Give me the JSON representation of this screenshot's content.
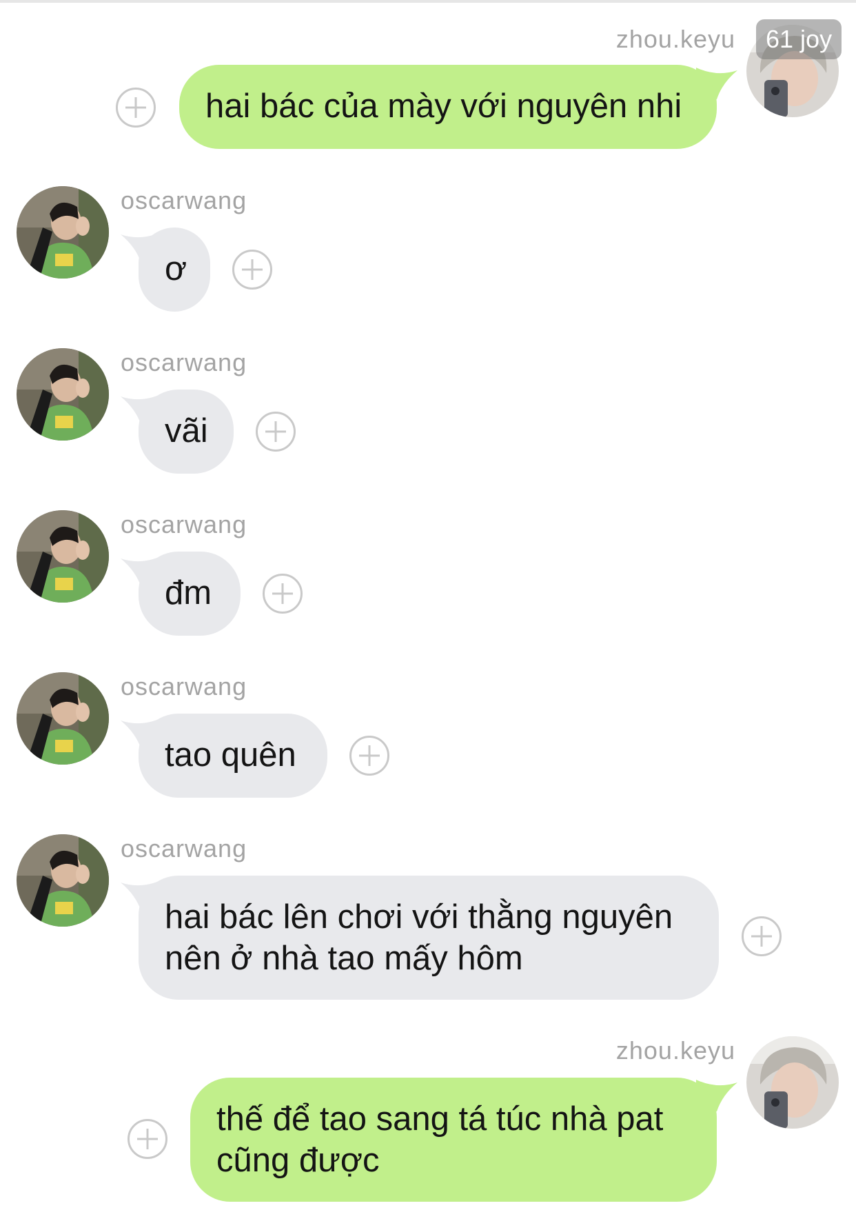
{
  "chat": {
    "overlay_badge": "61 joy",
    "messages": [
      {
        "sender": "zhou.keyu",
        "direction": "out",
        "text": "hai bác của mày với nguyên nhi"
      },
      {
        "sender": "oscarwang",
        "direction": "in",
        "text": "ơ"
      },
      {
        "sender": "oscarwang",
        "direction": "in",
        "text": "vãi"
      },
      {
        "sender": "oscarwang",
        "direction": "in",
        "text": "đm"
      },
      {
        "sender": "oscarwang",
        "direction": "in",
        "text": "tao quên"
      },
      {
        "sender": "oscarwang",
        "direction": "in",
        "text": "hai bác lên chơi với thằng nguyên\nnên ở nhà tao mấy hôm"
      },
      {
        "sender": "zhou.keyu",
        "direction": "out",
        "text": "thế để tao sang tá túc nhà pat\ncũng được"
      }
    ]
  },
  "icons": {
    "reaction": "add-reaction-icon",
    "avatar_in": "avatar-photo",
    "avatar_out": "avatar-photo"
  },
  "colors": {
    "outgoing_bubble": "#c1ef8b",
    "incoming_bubble": "#e8e9ec",
    "sender_name": "#a3a3a3",
    "reaction_icon": "#c9c9c9"
  }
}
